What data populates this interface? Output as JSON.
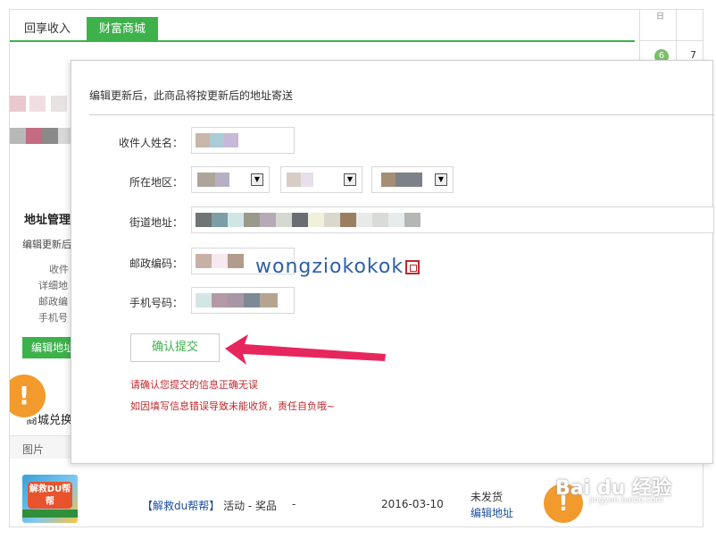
{
  "tabs": {
    "income": "回享收入",
    "mall": "财富商城"
  },
  "calendar": {
    "num_badge": "6",
    "seven": "7",
    "top_mark": "日"
  },
  "left_panel": {
    "title": "地址管理",
    "subtitle": "编辑更新后",
    "labels": [
      "收件",
      "详细地",
      "邮政编",
      "手机号"
    ],
    "edit_button": "编辑地址"
  },
  "shop_section": {
    "title": "商城兑换",
    "pic_header": "图片"
  },
  "order": {
    "product_image_text": "解救DU帮帮",
    "name_bracket": "【解救du帮帮】",
    "name_rest": "活动 - 奖品",
    "dash": "-",
    "date": "2016-03-10",
    "status": "未发货",
    "edit_link": "编辑地址"
  },
  "modal": {
    "notice": "编辑更新后，此商品将按更新后的地址寄送",
    "labels": {
      "name": "收件人姓名：",
      "region": "所在地区：",
      "street": "街道地址：",
      "postcode": "邮政编码：",
      "phone": "手机号码："
    },
    "submit": "确认提交",
    "warning1": "请确认您提交的信息正确无误",
    "warning2": "如因填写信息错误导致未能收货，责任自负哦~"
  },
  "watermark": "wongziokokok",
  "baidu_logo": "Bai du 经验",
  "baidu_sub": "jingyan.baidu.com",
  "colors": {
    "accent": "#3db24b",
    "warning_red": "#c0282c",
    "link": "#1a4e9e",
    "arrow": "#e8265e",
    "badge_orange": "#f29a2c"
  },
  "icons": {
    "warning": "exclamation-icon",
    "select": "chevron-down-icon",
    "arrow": "arrow-left-icon"
  }
}
